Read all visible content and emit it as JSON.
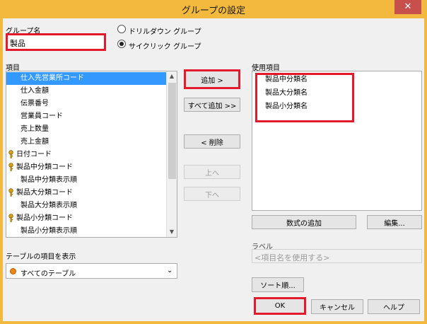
{
  "window": {
    "title": "グループの設定",
    "close_label": "✕"
  },
  "group_name": {
    "label": "グループ名",
    "value": "製品"
  },
  "group_type": {
    "options": [
      {
        "label": "ドリルダウン グループ",
        "checked": false
      },
      {
        "label": "サイクリック グループ",
        "checked": true
      }
    ]
  },
  "fields": {
    "label": "項目",
    "items": [
      {
        "label": "仕入先営業所コード",
        "selected": true,
        "key": false
      },
      {
        "label": "仕入金額",
        "selected": false,
        "key": false
      },
      {
        "label": "伝票番号",
        "selected": false,
        "key": false
      },
      {
        "label": "営業員コード",
        "selected": false,
        "key": false
      },
      {
        "label": "売上数量",
        "selected": false,
        "key": false
      },
      {
        "label": "売上金額",
        "selected": false,
        "key": false
      },
      {
        "label": "日付コード",
        "selected": false,
        "key": true
      },
      {
        "label": "製品中分類コード",
        "selected": false,
        "key": true
      },
      {
        "label": "製品中分類表示順",
        "selected": false,
        "key": false
      },
      {
        "label": "製品大分類コード",
        "selected": false,
        "key": true
      },
      {
        "label": "製品大分類表示順",
        "selected": false,
        "key": false
      },
      {
        "label": "製品小分類コード",
        "selected": false,
        "key": true
      },
      {
        "label": "製品小分類表示順",
        "selected": false,
        "key": false
      }
    ]
  },
  "buttons": {
    "add": "追加 >",
    "add_all": "すべて追加 >>",
    "remove": "< 削除",
    "up": "上へ",
    "down": "下へ"
  },
  "used_fields": {
    "label": "使用項目",
    "items": [
      "製品中分類名",
      "製品大分類名",
      "製品小分類名"
    ]
  },
  "formula_button": "数式の追加",
  "edit_button": "編集...",
  "label_section": {
    "label": "ラベル",
    "placeholder": "<項目名を使用する>"
  },
  "table_filter": {
    "label": "テーブルの項目を表示",
    "selected": "すべてのテーブル"
  },
  "sort_button": "ソート順...",
  "footer": {
    "ok": "OK",
    "cancel": "キャンセル",
    "help": "ヘルプ"
  }
}
